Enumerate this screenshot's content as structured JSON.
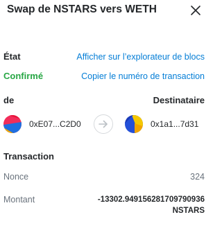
{
  "header": {
    "title": "Swap de NSTARS vers WETH"
  },
  "status": {
    "label": "État",
    "value": "Confirmé",
    "explorer_link": "Afficher sur l’explorateur de blocs",
    "copy_link": "Copier le numéro de transaction"
  },
  "addresses": {
    "from_label": "de",
    "to_label": "Destinataire",
    "from_address": "0xE07...C2D0",
    "to_address": "0x1a1...7d31"
  },
  "transaction": {
    "title": "Transaction",
    "nonce_label": "Nonce",
    "nonce_value": "324",
    "amount_label": "Montant",
    "amount_value": "-13302.949156281709790936",
    "amount_unit": "NSTARS"
  },
  "colors": {
    "confirmed": "#28a745",
    "link": "#037dd6",
    "muted": "#6a737d"
  }
}
